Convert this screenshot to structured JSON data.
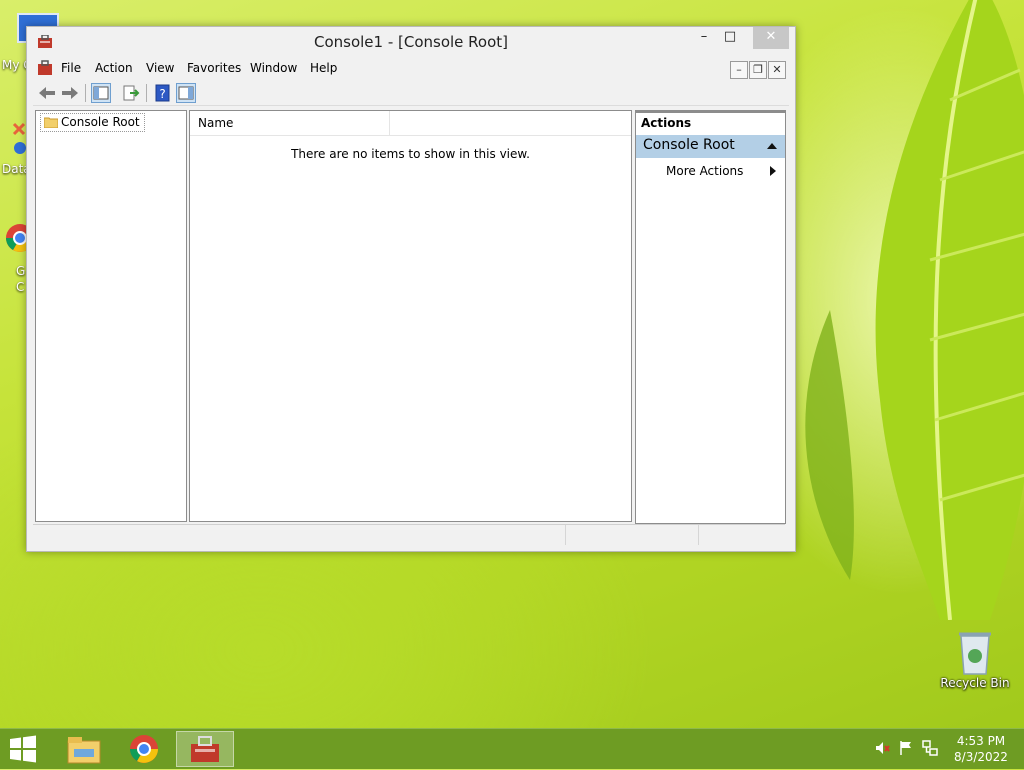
{
  "window": {
    "title": "Console1 - [Console Root]"
  },
  "menu": {
    "items": [
      "File",
      "Action",
      "View",
      "Favorites",
      "Window",
      "Help"
    ]
  },
  "tree": {
    "root_label": "Console Root"
  },
  "list": {
    "columns": [
      "Name"
    ],
    "empty_message": "There are no items to show in this view."
  },
  "actions": {
    "title": "Actions",
    "section": "Console Root",
    "items": [
      "More Actions"
    ]
  },
  "desktop": {
    "icons": [
      {
        "label": "Recycle Bin",
        "icon": "recycle-bin-icon"
      }
    ],
    "partial_labels": [
      "My C",
      "Data",
      "G",
      "C"
    ]
  },
  "taskbar": {
    "pinned": [
      "file-explorer-icon",
      "chrome-icon",
      "mmc-console-icon"
    ],
    "tray": [
      "volume-muted-icon",
      "action-center-flag-icon",
      "network-icon"
    ],
    "clock": {
      "time": "4:53 PM",
      "date": "8/3/2022"
    }
  },
  "colors": {
    "taskbar": "#6e9c23",
    "actions_section": "#b3cfe6",
    "close_button": "#c7c7c7"
  }
}
